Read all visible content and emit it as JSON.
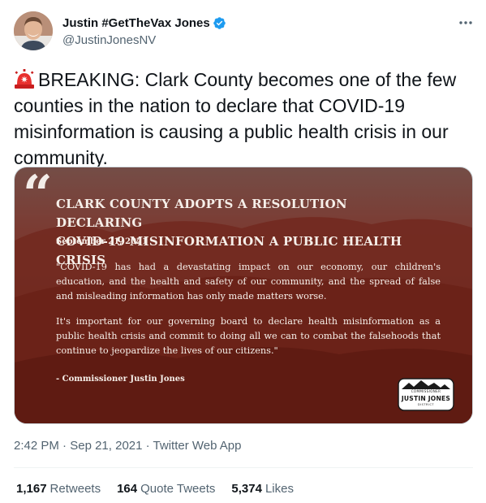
{
  "author": {
    "display_name": "Justin #GetTheVax Jones",
    "handle": "@JustinJonesNV",
    "verified": true,
    "avatar_icon": "profile-photo"
  },
  "tweet": {
    "text": "BREAKING: Clark County becomes one of the few counties in the nation to declare that COVID-19 misinformation is causing a public health crisis in our community.",
    "leading_emoji": "rotating-light-icon"
  },
  "media": {
    "title_line1": "CLARK COUNTY ADOPTS A RESOLUTION DECLARING",
    "title_line2": "COVID-19 MISINFORMATION A PUBLIC HEALTH CRISIS",
    "date": "September 21, 2021",
    "quote_p1": "\"COVID-19 has had a devastating impact on our economy, our children's education, and the health and safety of our community, and the spread of false and misleading information has only made matters worse.",
    "quote_p2": "It's important for our governing board to declare health misinformation as a public health crisis and commit to doing all we can to combat the falsehoods that continue to jeopardize the lives of our citizens.\"",
    "attribution": "- Commissioner Justin Jones",
    "logo_top": "COMMISSIONER",
    "logo_name": "JUSTIN JONES",
    "logo_bottom": "DISTRICT"
  },
  "meta": {
    "time": "2:42 PM",
    "date": "Sep 21, 2021",
    "source": "Twitter Web App"
  },
  "stats": [
    {
      "count": "1,167",
      "label": "Retweets"
    },
    {
      "count": "164",
      "label": "Quote Tweets"
    },
    {
      "count": "5,374",
      "label": "Likes"
    }
  ],
  "colors": {
    "verified_blue": "#1d9bf0",
    "secondary_text": "#536471",
    "media_red": "#7a2a22"
  }
}
